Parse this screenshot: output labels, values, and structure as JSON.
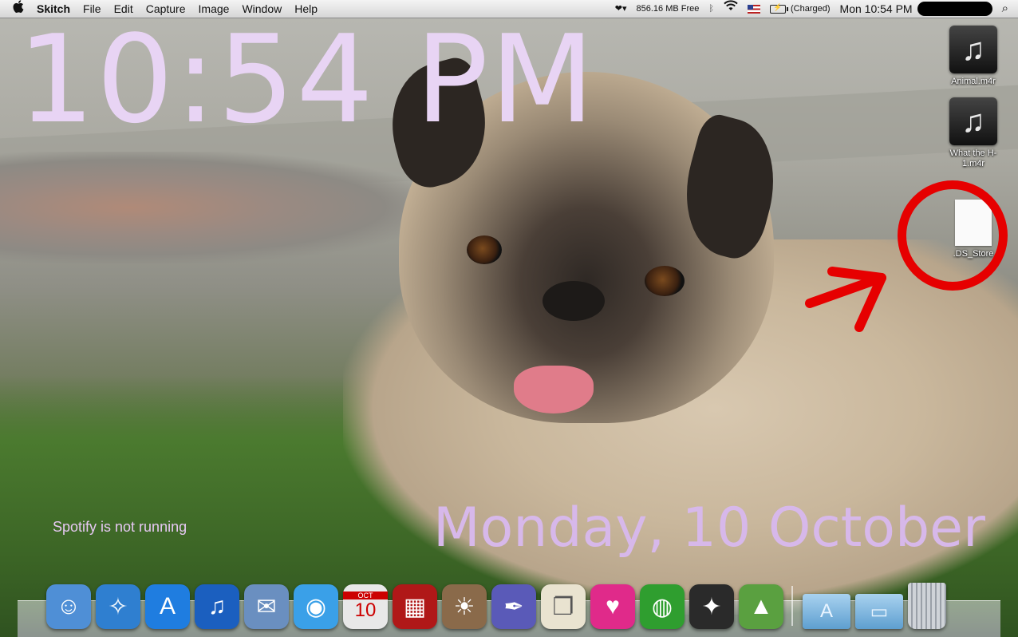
{
  "menubar": {
    "apple_menu": "",
    "app_name": "Skitch",
    "menus": [
      "File",
      "Edit",
      "Capture",
      "Image",
      "Window",
      "Help"
    ],
    "status": {
      "memory_free": "856.16 MB Free",
      "battery": "(Charged)",
      "clock": "Mon 10:54 PM",
      "bluetooth_glyph": "ᛒ",
      "wifi_glyph": "◔",
      "spotlight_glyph": "⌕",
      "heart_glyph": "❤▾"
    }
  },
  "desktop_widgets": {
    "time": "10:54 PM",
    "date": "Monday, 10 October",
    "spotify_status": "Spotify is not running"
  },
  "desktop_icons": [
    {
      "label": "Animal.m4r",
      "kind": "music-file"
    },
    {
      "label": "What the H- 1.m4r",
      "kind": "music-file"
    },
    {
      "label": ".DS_Store",
      "kind": "blank-file"
    }
  ],
  "dock": {
    "apps": [
      {
        "name": "Finder",
        "glyph": "☺",
        "bg": "#4f8fd6"
      },
      {
        "name": "Safari",
        "glyph": "✧",
        "bg": "#2f7fd0"
      },
      {
        "name": "App Store",
        "glyph": "A",
        "bg": "#1f7de0"
      },
      {
        "name": "iTunes",
        "glyph": "♫",
        "bg": "#1b5fbf"
      },
      {
        "name": "Mail",
        "glyph": "✉",
        "bg": "#6a8fc0"
      },
      {
        "name": "iChat",
        "glyph": "◉",
        "bg": "#3aa0e8"
      },
      {
        "name": "iCal",
        "glyph": "10",
        "bg": "#e8e8e8",
        "fg": "#c00",
        "sub": "OCT"
      },
      {
        "name": "Photo Booth",
        "glyph": "▦",
        "bg": "#b01818"
      },
      {
        "name": "iPhoto",
        "glyph": "☀",
        "bg": "#8a6a4a"
      },
      {
        "name": "Pen Tool",
        "glyph": "✒",
        "bg": "#5a5ab8"
      },
      {
        "name": "Dictionary",
        "glyph": "❐",
        "bg": "#e9e3d0",
        "fg": "#555"
      },
      {
        "name": "Heart App",
        "glyph": "♥",
        "bg": "#e02a8a"
      },
      {
        "name": "Spotify",
        "glyph": "◍",
        "bg": "#2f9e2f"
      },
      {
        "name": "Magic Hat",
        "glyph": "✦",
        "bg": "#2a2a2a"
      },
      {
        "name": "Weather",
        "glyph": "▲",
        "bg": "#5aa040"
      }
    ],
    "stacks": [
      {
        "name": "Applications",
        "glyph": "A"
      },
      {
        "name": "Documents",
        "glyph": "▭"
      }
    ]
  },
  "annotation": {
    "color": "#e60000"
  }
}
